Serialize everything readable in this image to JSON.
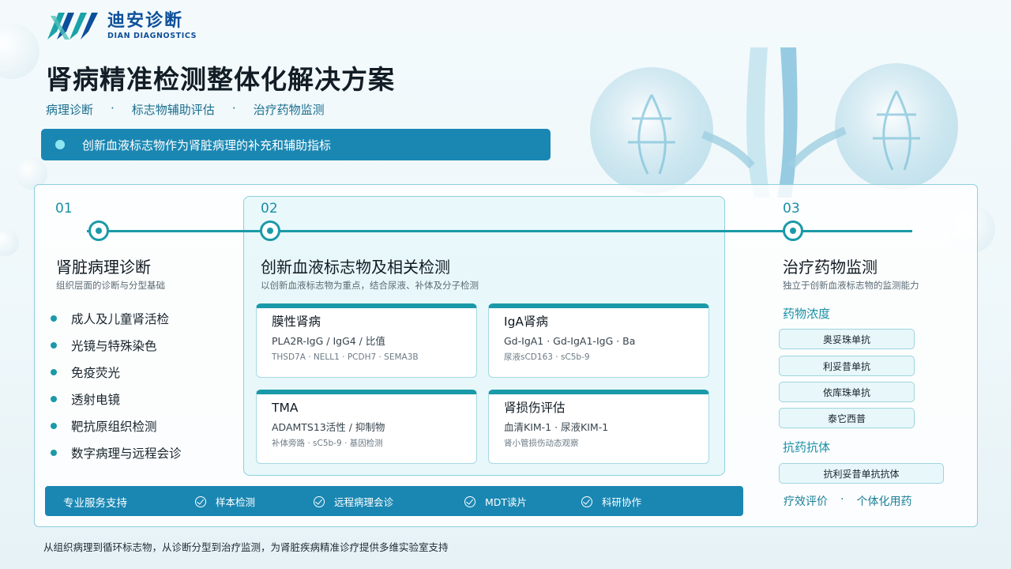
{
  "logo": {
    "cn": "迪安诊断",
    "en": "DIAN DIAGNOSTICS"
  },
  "title": "肾病精准检测整体化解决方案",
  "subnav": [
    "病理诊断",
    "标志物辅助评估",
    "治疗药物监测"
  ],
  "subnav_sep": "·",
  "banner": "创新血液标志物作为肾脏病理的补充和辅助指标",
  "col1": {
    "num": "01",
    "title": "肾脏病理诊断",
    "sub": "组织层面的诊断与分型基础",
    "items": [
      "成人及儿童肾活检",
      "光镜与特殊染色",
      "免疫荧光",
      "透射电镜",
      "靶抗原组织检测",
      "数字病理与远程会诊"
    ]
  },
  "col2": {
    "num": "02",
    "title": "创新血液标志物及相关检测",
    "sub": "以创新血液标志物为重点，结合尿液、补体及分子检测",
    "cards": [
      {
        "title": "膜性肾病",
        "main": "PLA2R-IgG / IgG4 / 比值",
        "sub": "THSD7A · NELL1 · PCDH7 · SEMA3B"
      },
      {
        "title": "IgA肾病",
        "main": "Gd-IgA1 · Gd-IgA1-IgG · Ba",
        "sub": "尿液sCD163 · sC5b-9"
      },
      {
        "title": "TMA",
        "main": "ADAMTS13活性 / 抑制物",
        "sub": "补体旁路 · sC5b-9 · 基因检测"
      },
      {
        "title": "肾损伤评估",
        "main": "血清KIM-1 · 尿液KIM-1",
        "sub": "肾小管损伤动态观察"
      }
    ]
  },
  "col3": {
    "num": "03",
    "title": "治疗药物监测",
    "sub": "独立于创新血液标志物的监测能力",
    "drug_label": "药物浓度",
    "drugs": [
      "奥妥珠单抗",
      "利妥昔单抗",
      "依库珠单抗",
      "泰它西普"
    ],
    "ada_label": "抗药抗体",
    "ada": [
      "抗利妥昔单抗抗体"
    ],
    "eff": [
      "疗效评价",
      "个体化用药"
    ],
    "eff_sep": "·"
  },
  "service": {
    "label": "专业服务支持",
    "items": [
      "样本检测",
      "远程病理会诊",
      "MDT读片",
      "科研协作"
    ]
  },
  "footer": "从组织病理到循环标志物，从诊断分型到治疗监测，为肾脏疾病精准诊疗提供多维实验室支持",
  "colors": {
    "accent": "#1a9aa8",
    "banner": "#1a87b3",
    "brand": "#0d4f9a"
  }
}
